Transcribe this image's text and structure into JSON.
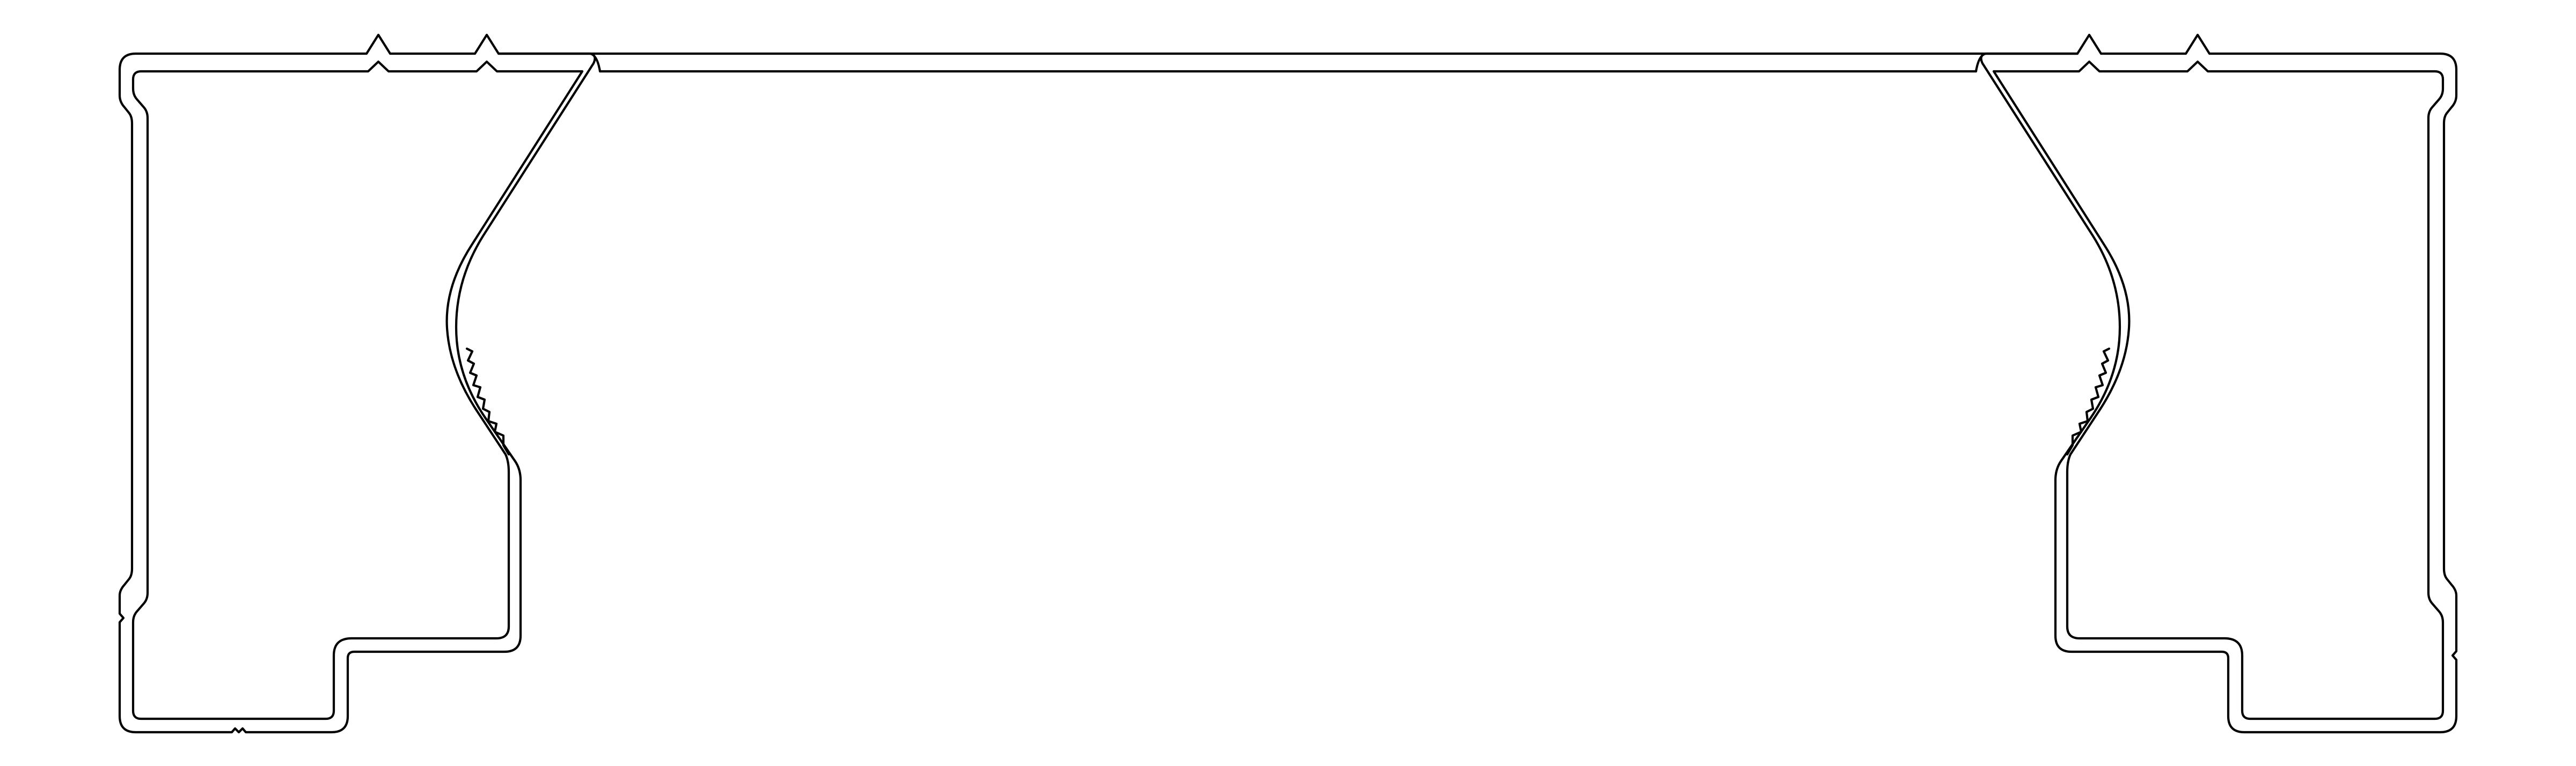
{
  "drawing": {
    "kind": "extrusion-profile-cross-section",
    "symmetry": "mirror-left-right",
    "background_color": "#ffffff",
    "line_color": "#000000",
    "text_labels": []
  }
}
